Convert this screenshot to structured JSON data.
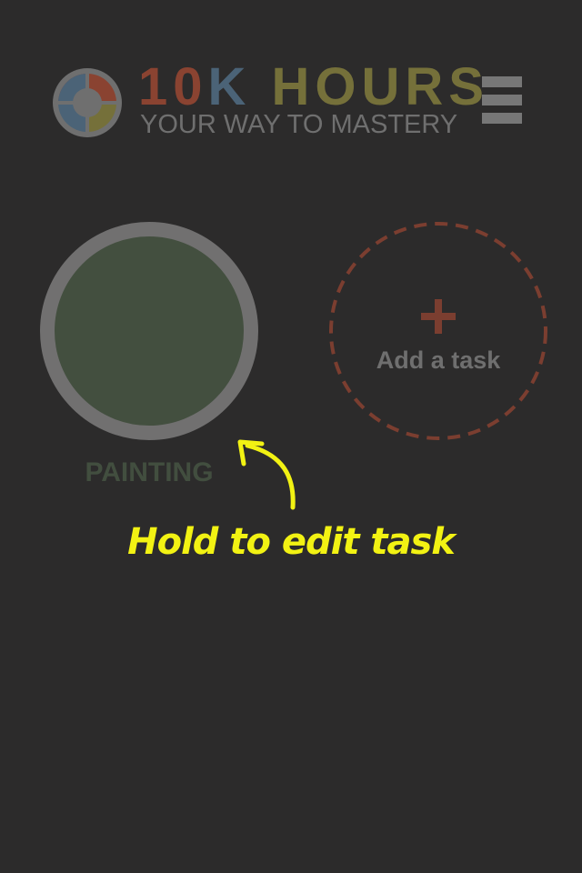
{
  "header": {
    "logo_icon": "pie-wheel-logo",
    "title_parts": [
      "10",
      "K",
      "HOURS"
    ],
    "title_colors": [
      "#8a4331",
      "#4b6377",
      "#75703a"
    ],
    "subtitle": "YOUR WAY TO MASTERY",
    "subtitle_color": "#6f6f6f",
    "menu_icon": "hamburger-menu-icon"
  },
  "logo_colors": {
    "top_left": "#8a4331",
    "top_right": "#4b6377",
    "bottom_right": "#75703a",
    "bottom_left": "#4b6377",
    "ring": "#6f6f6f",
    "center": "#6f6f6f"
  },
  "tasks": [
    {
      "label": "PAINTING",
      "fill_color": "#434f3f",
      "ring_color": "#717070",
      "label_color": "#424e3f"
    }
  ],
  "add_task": {
    "label": "Add a task",
    "icon": "plus-icon",
    "accent_color": "#7b3e30",
    "label_color": "#6f6f6f"
  },
  "hint": {
    "text": "Hold to edit task",
    "color": "#f2f213",
    "icon": "curved-arrow-icon"
  },
  "colors": {
    "background": "#2c2b2b"
  }
}
